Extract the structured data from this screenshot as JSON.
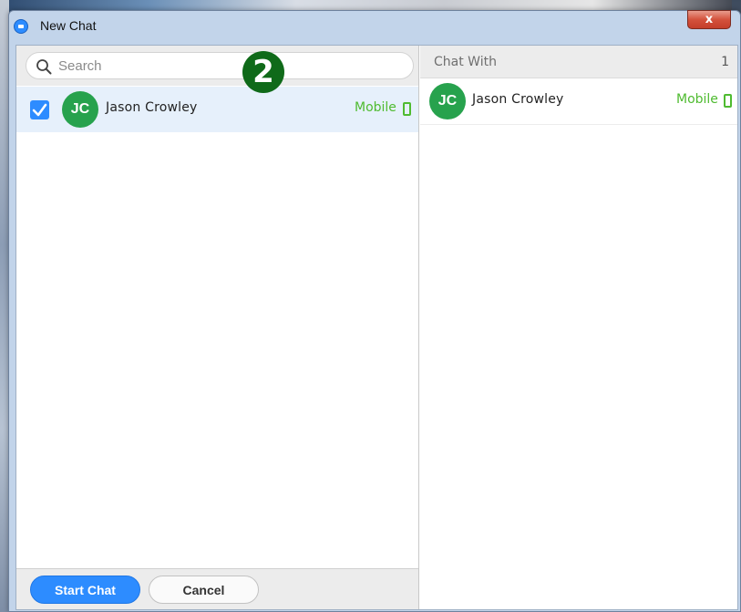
{
  "window": {
    "title": "New Chat",
    "close_label": "x"
  },
  "search": {
    "placeholder": "Search"
  },
  "annotation": {
    "step_number": "2"
  },
  "contacts": [
    {
      "initials": "JC",
      "name": "Jason  Crowley",
      "status": "Mobile",
      "checked": true
    }
  ],
  "chat_with": {
    "label": "Chat With",
    "count": "1",
    "selected": [
      {
        "initials": "JC",
        "name": "Jason  Crowley",
        "status": "Mobile"
      }
    ]
  },
  "footer": {
    "start_label": "Start Chat",
    "cancel_label": "Cancel"
  },
  "colors": {
    "accent": "#2d8cff",
    "avatar": "#27a24d",
    "mobile_status": "#4fbb30",
    "annotation_badge": "#0f6a19"
  }
}
